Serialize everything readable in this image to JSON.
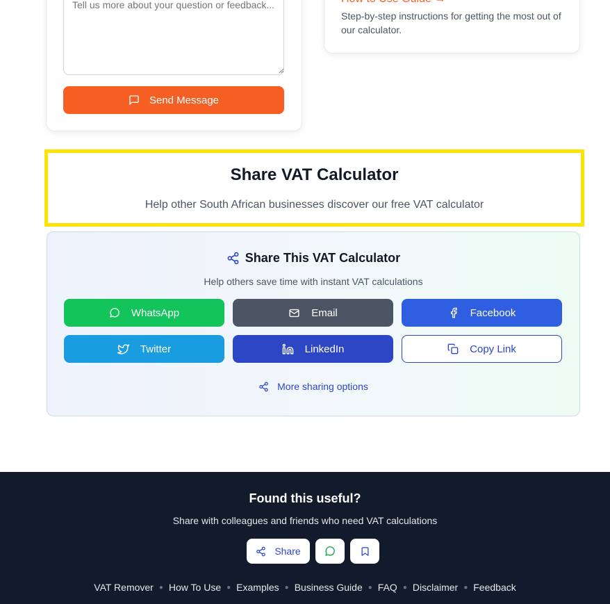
{
  "contact": {
    "message_placeholder": "Tell us more about your question or feedback...",
    "send_label": "Send Message"
  },
  "guide": {
    "link_label": "How to Use Guide →",
    "description": "Step-by-step instructions for getting the most out of our calculator."
  },
  "share_header": {
    "title": "Share VAT Calculator",
    "subtitle": "Help other South African businesses discover our free VAT calculator"
  },
  "share_panel": {
    "title": "Share This VAT Calculator",
    "subtitle": "Help others save time with instant VAT calculations",
    "buttons": {
      "whatsapp": "WhatsApp",
      "email": "Email",
      "facebook": "Facebook",
      "twitter": "Twitter",
      "linkedin": "LinkedIn",
      "copy_link": "Copy Link"
    },
    "more_options": "More sharing options"
  },
  "footer": {
    "title": "Found this useful?",
    "subtitle": "Share with colleagues and friends who need VAT calculations",
    "share_label": "Share",
    "links": [
      "VAT Remover",
      "How To Use",
      "Examples",
      "Business Guide",
      "FAQ",
      "Disclaimer",
      "Feedback"
    ]
  },
  "colors": {
    "accent_orange": "#f55f24",
    "highlight_yellow": "#fde300",
    "whatsapp_green": "#13c45a",
    "email_gray": "#4b5563",
    "facebook_blue": "#2f5ee0",
    "twitter_blue": "#1a9de0",
    "linkedin_blue": "#2d46c6",
    "footer_bg": "#131a2c"
  },
  "icons": [
    "message-square-icon",
    "share-icon",
    "whatsapp-icon",
    "mail-icon",
    "facebook-icon",
    "twitter-icon",
    "linkedin-icon",
    "copy-icon",
    "bookmark-icon"
  ]
}
